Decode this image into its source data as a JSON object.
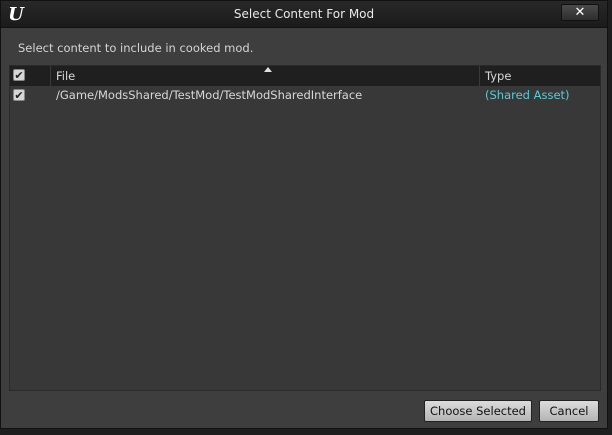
{
  "window": {
    "title": "Select Content For Mod",
    "close_glyph": "✕"
  },
  "instruction": "Select content to include in cooked mod.",
  "table": {
    "columns": {
      "file": "File",
      "type": "Type"
    },
    "rows": [
      {
        "file": "/Game/ModsShared/TestMod/TestModSharedInterface",
        "type": "(Shared Asset)",
        "checked": true
      }
    ]
  },
  "buttons": {
    "choose_selected": "Choose Selected",
    "cancel": "Cancel"
  },
  "icons": {
    "logo": "unreal-engine-logo",
    "check": "checkmark-icon"
  },
  "colors": {
    "accent_type": "#5ec9d6"
  }
}
